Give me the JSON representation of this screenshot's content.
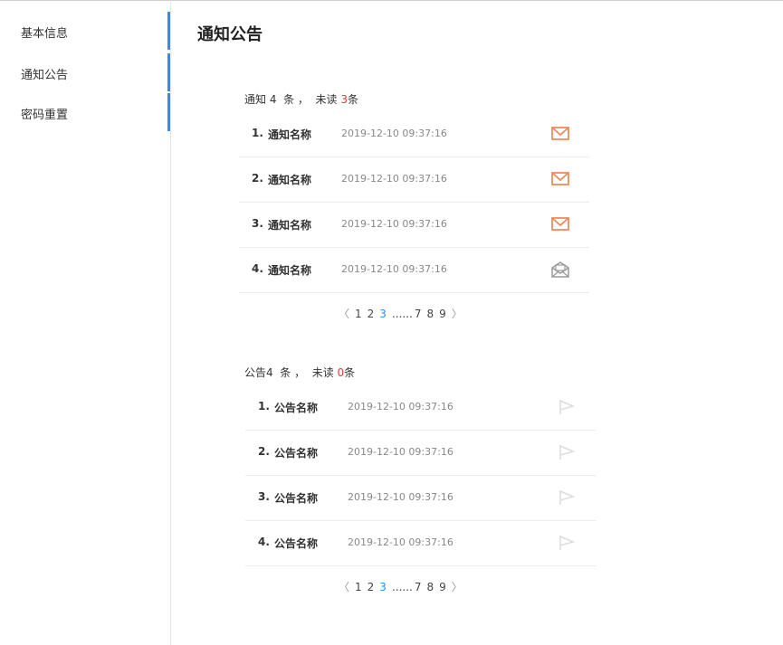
{
  "sidebar": {
    "items": [
      {
        "label": "基本信息"
      },
      {
        "label": "通知公告"
      },
      {
        "label": "密码重置"
      }
    ]
  },
  "main": {
    "title": "通知公告"
  },
  "notices": {
    "summary_prefix": "通知 4  条 ，  未读 ",
    "unread": "3",
    "summary_suffix": "条",
    "rows": [
      {
        "num": "1.",
        "name": "通知名称",
        "time": "2019-12-10 09:37:16",
        "icon": "mail-unread-icon"
      },
      {
        "num": "2.",
        "name": "通知名称",
        "time": "2019-12-10 09:37:16",
        "icon": "mail-unread-icon"
      },
      {
        "num": "3.",
        "name": "通知名称",
        "time": "2019-12-10 09:37:16",
        "icon": "mail-unread-icon"
      },
      {
        "num": "4.",
        "name": "通知名称",
        "time": "2019-12-10 09:37:16",
        "icon": "mail-read-icon"
      }
    ],
    "pagination": {
      "prev": "〈",
      "pages": [
        "1",
        "2",
        "3",
        "......",
        "7",
        "8",
        "9"
      ],
      "current": "3",
      "next": "〉"
    }
  },
  "announcements": {
    "summary_prefix": "公告4  条 ，  未读 ",
    "unread": "0",
    "summary_suffix": "条",
    "rows": [
      {
        "num": "1.",
        "name": "公告名称",
        "time": "2019-12-10 09:37:16",
        "icon": "flag-icon"
      },
      {
        "num": "2.",
        "name": "公告名称",
        "time": "2019-12-10 09:37:16",
        "icon": "flag-icon"
      },
      {
        "num": "3.",
        "name": "公告名称",
        "time": "2019-12-10 09:37:16",
        "icon": "flag-icon"
      },
      {
        "num": "4.",
        "name": "公告名称",
        "time": "2019-12-10 09:37:16",
        "icon": "flag-icon"
      }
    ],
    "pagination": {
      "prev": "〈",
      "pages": [
        "1",
        "2",
        "3",
        "......",
        "7",
        "8",
        "9"
      ],
      "current": "3",
      "next": "〉"
    }
  },
  "colors": {
    "accent": "#2b8ff0",
    "unread_red": "#e53935",
    "mail_orange": "#f08a5d",
    "read_gray": "#9a9a9a",
    "flag_faint": "#dddddd"
  }
}
